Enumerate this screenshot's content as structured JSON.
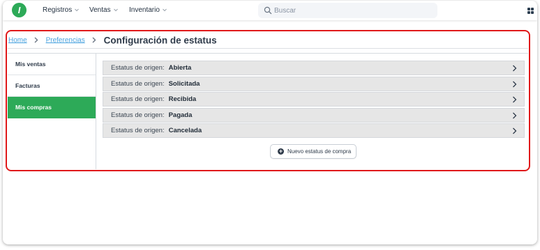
{
  "topbar": {
    "logo_letter": "I",
    "nav": [
      {
        "label": "Registros"
      },
      {
        "label": "Ventas"
      },
      {
        "label": "Inventario"
      }
    ],
    "search": {
      "placeholder": "Buscar",
      "value": ""
    }
  },
  "breadcrumb": {
    "home": "Home",
    "preferences": "Preferencias",
    "title": "Configuración de estatus"
  },
  "sidebar": {
    "items": [
      {
        "label": "Mis ventas",
        "active": false
      },
      {
        "label": "Facturas",
        "active": false
      },
      {
        "label": "Mis compras",
        "active": true
      }
    ]
  },
  "statuses": {
    "prefix": "Estatus de origen:",
    "items": [
      {
        "value": "Abierta"
      },
      {
        "value": "Solicitada"
      },
      {
        "value": "Recibida"
      },
      {
        "value": "Pagada"
      },
      {
        "value": "Cancelada"
      }
    ]
  },
  "actions": {
    "new_status_label": "Nuevo estatus de compra"
  },
  "colors": {
    "brand_green": "#2daa58",
    "highlight_red": "#e0191a",
    "link_blue": "#4aa3df",
    "row_gray": "#e6e6e6"
  }
}
